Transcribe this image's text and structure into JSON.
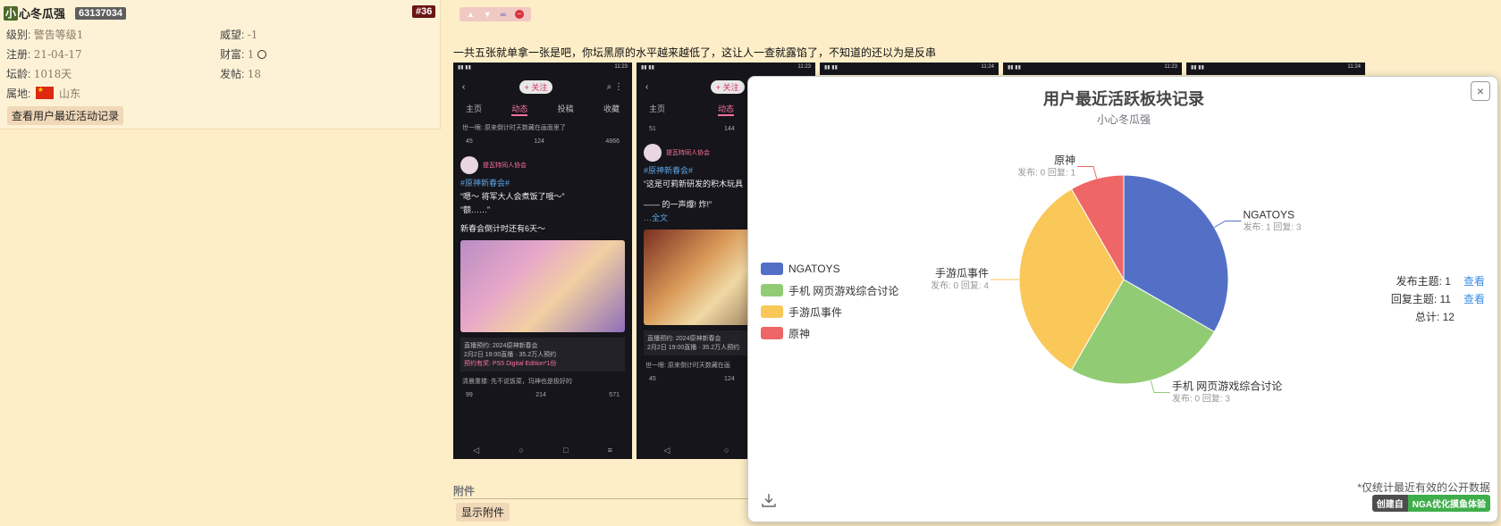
{
  "user": {
    "avatar_char": "小",
    "name": "心冬瓜强",
    "uid": "63137034",
    "floor": "#36",
    "level_label": "级别:",
    "level_value": "警告等级1",
    "prestige_label": "威望:",
    "prestige_value": "-1",
    "register_label": "注册:",
    "register_value": "21-04-17",
    "wealth_label": "财富:",
    "wealth_value": "1",
    "age_label": "坛龄:",
    "age_value": "1018天",
    "posts_label": "发帖:",
    "posts_value": "18",
    "location_label": "属地:",
    "location_value": "山东",
    "activity_button": "查看用户最近活动记录"
  },
  "post": {
    "text": "一共五张就单拿一张是吧，你坛黑原的水平越来越低了，这让人一查就露馅了，不知道的还以为是反串",
    "attachment_title": "附件",
    "attachment_button": "显示附件"
  },
  "phone": {
    "follow": "+ 关注",
    "tabs": [
      "主页",
      "动态",
      "投稿",
      "收藏"
    ],
    "comment_line": "世一眼: 原来倒计时天数藏在画面里了",
    "stats": [
      "45",
      "124",
      "4866"
    ],
    "author": "提瓦特同人协会",
    "author_time": "3天前",
    "tag": "#原神新春会#",
    "line1": "“嗯～ 将军大人会煮饭了哦～”",
    "line2": "“额……”",
    "line3": "新春会倒计时还有6天～",
    "more": "…全文",
    "card_title": "直播预约: 2024原神新春会",
    "card_sub": "2月2日 19:00直播 · 35.2万人预约",
    "card_gift": "预约有奖: PS5 Digital Edition*1份",
    "card_badge": "已预约",
    "comment2": "清晨重楼: 先不说饭菜，玛神也是极好的",
    "stats2": [
      "99",
      "214",
      "571"
    ],
    "b_line1": "“这是可莉新研发的积木玩具",
    "b_line2": "—— 的一声爆! 炸!”",
    "b_stats": [
      "51",
      "144"
    ],
    "b_stats2": [
      "45",
      "124"
    ],
    "b_comment": "世一眼: 原来倒计时天数藏在画",
    "time_a": "11:23",
    "time_b": "11:24"
  },
  "popup": {
    "title": "用户最近活跃板块记录",
    "subtitle": "小心冬瓜强",
    "close": "×",
    "stats": {
      "publish_label": "发布主题: 1",
      "reply_label": "回复主题: 11",
      "total_label": "总计: 12",
      "view_link": "查看"
    },
    "note": "*仅统计最近有效的公开数据",
    "brand_a": "创建自",
    "brand_b": "NGA优化摸鱼体验"
  },
  "chart_data": {
    "type": "pie",
    "title": "用户最近活跃板块记录",
    "subtitle": "小心冬瓜强",
    "legend_position": "left",
    "slices": [
      {
        "name": "NGATOYS",
        "value": 4,
        "detail": "发布: 1 回复: 3",
        "color": "#5470c6"
      },
      {
        "name": "手机 网页游戏综合讨论",
        "value": 3,
        "detail": "发布: 0 回复: 3",
        "color": "#91cc75"
      },
      {
        "name": "手游瓜事件",
        "value": 4,
        "detail": "发布: 0 回复: 4",
        "color": "#fac858"
      },
      {
        "name": "原神",
        "value": 1,
        "detail": "发布: 0 回复: 1",
        "color": "#ee6666"
      }
    ]
  }
}
